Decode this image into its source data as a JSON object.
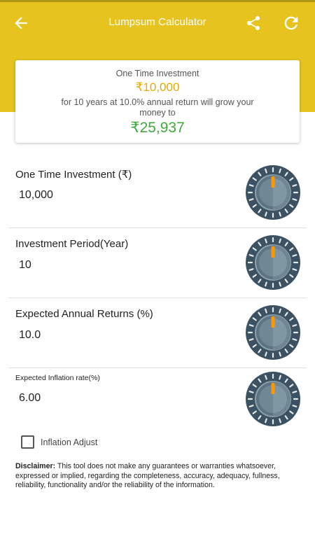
{
  "colors": {
    "accent": "#e6c31f",
    "amount": "#e6a800",
    "result": "#3fa93a",
    "knob_dark": "#3c5262",
    "knob_mark": "#ff9800"
  },
  "header": {
    "title": "Lumpsum Calculator",
    "icons": {
      "back": "arrow-left-icon",
      "share": "share-icon",
      "refresh": "refresh-icon"
    }
  },
  "summary": {
    "label": "One Time Investment",
    "amount": "₹10,000",
    "description": "for 10 years at 10.0% annual return will grow your money to",
    "result": "₹25,937"
  },
  "fields": [
    {
      "label": "One Time Investment (₹)",
      "value": "10,000"
    },
    {
      "label": "Investment Period(Year)",
      "value": "10"
    },
    {
      "label": "Expected Annual Returns (%)",
      "value": "10.0"
    },
    {
      "label": "Expected Inflation rate(%)",
      "value": "6.00"
    }
  ],
  "inflation_adjust": {
    "label": "Inflation Adjust",
    "checked": false
  },
  "disclaimer": {
    "title": "Disclaimer:",
    "text": " This tool does not make any guarantees or warranties whatsoever, expressed or implied, regarding the completeness, accuracy, adequacy, fullness, reliability, functionality and/or the reliability of the information."
  }
}
